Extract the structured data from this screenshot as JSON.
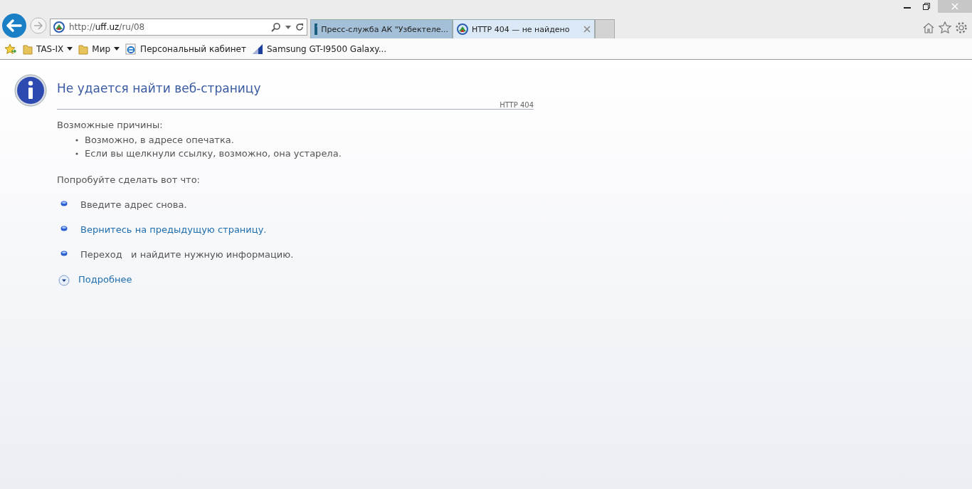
{
  "address_bar": {
    "url": "http://**uff.uz**/ru/08"
  },
  "tabs": [
    {
      "title": "Пресс-служба АК \"Узбектеле...",
      "selected": false,
      "kind": "v"
    },
    {
      "title": "HTTP 404 — не найдено",
      "selected": true,
      "kind": "site"
    }
  ],
  "favorites": [
    {
      "label": "TAS-IX",
      "kind": "folder"
    },
    {
      "label": "Мир",
      "kind": "folder"
    },
    {
      "label": "Персональный кабинет",
      "kind": "ie"
    },
    {
      "label": "Samsung GT-I9500 Galaxy...",
      "kind": "page"
    }
  ],
  "page": {
    "title": "Не удается найти веб-страницу",
    "code": "HTTP 404",
    "causes_heading": "Возможные причины:",
    "causes": [
      "Возможно, в адресе опечатка.",
      "Если вы щелкнули ссылку, возможно, она устарела."
    ],
    "try_heading": "Попробуйте сделать вот что:",
    "suggestions": [
      {
        "text": "Введите адрес снова.",
        "kind": "text"
      },
      {
        "text": "Вернитесь на предыдущую страницу.",
        "kind": "link"
      },
      {
        "text": "Переход   и найдите нужную информацию.",
        "kind": "text"
      }
    ],
    "more": "Подробнее"
  }
}
